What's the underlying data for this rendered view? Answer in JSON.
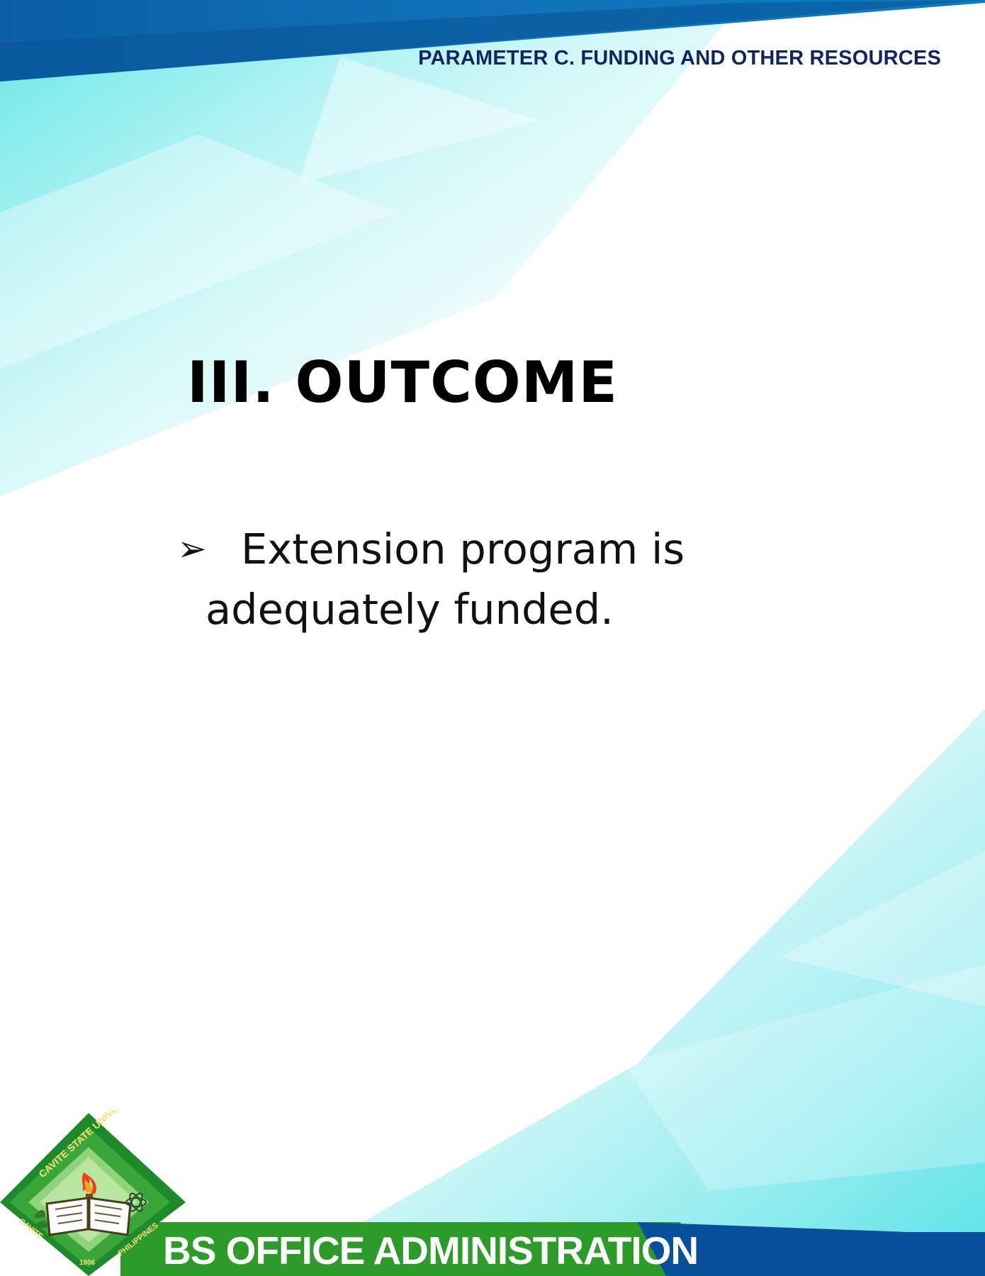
{
  "header": {
    "parameter_label": "PARAMETER C. FUNDING AND OTHER RESOURCES"
  },
  "content": {
    "section_title": "III. OUTCOME",
    "bullet_icon": "arrow-bullet-icon",
    "bullet_line1": "Extension program is",
    "bullet_line2": "adequately funded."
  },
  "footer": {
    "program_name": "BS OFFICE ADMINISTRATION",
    "seal_text_top": "CAVITE STATE UNIVERSITY",
    "seal_text_bottom_left": "CAVITE",
    "seal_text_bottom_right": "PHILIPPINES",
    "seal_year": "1906"
  },
  "colors": {
    "header_blue": "#0b5fa6",
    "header_text": "#13255f",
    "teal_accent": "#5fe3e6",
    "footer_green": "#2e9a2a",
    "footer_blue": "#0a4f9c"
  }
}
